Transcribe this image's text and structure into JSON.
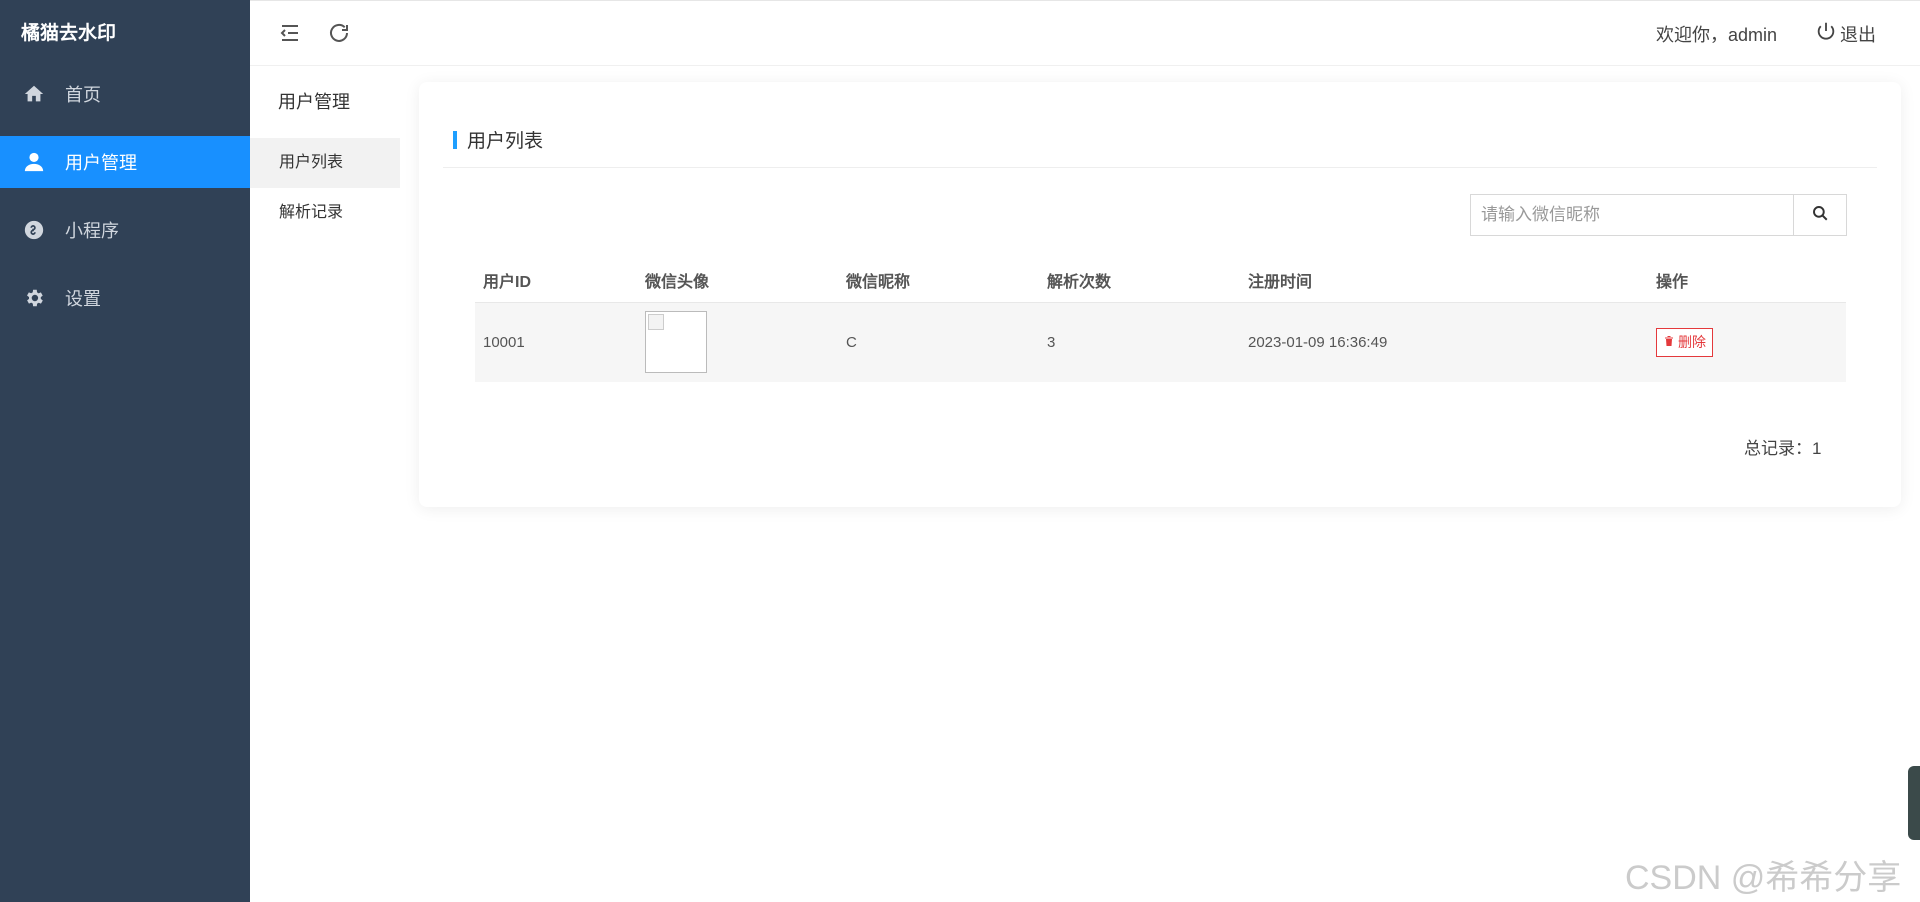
{
  "app": {
    "title": "橘猫去水印"
  },
  "sidebar": {
    "items": [
      {
        "label": "首页",
        "icon": "home-icon"
      },
      {
        "label": "用户管理",
        "icon": "user-icon",
        "active": true
      },
      {
        "label": "小程序",
        "icon": "miniprogram-icon"
      },
      {
        "label": "设置",
        "icon": "gear-icon"
      }
    ]
  },
  "header": {
    "welcome": "欢迎你，admin",
    "logout_label": "退出"
  },
  "submenu": {
    "title": "用户管理",
    "items": [
      {
        "label": "用户列表",
        "active": true
      },
      {
        "label": "解析记录"
      }
    ]
  },
  "card": {
    "title": "用户列表"
  },
  "search": {
    "placeholder": "请输入微信昵称",
    "value": ""
  },
  "table": {
    "columns": [
      "用户ID",
      "微信头像",
      "微信昵称",
      "解析次数",
      "注册时间",
      "操作"
    ],
    "rows": [
      {
        "id": "10001",
        "nickname": "C",
        "count": "3",
        "registered": "2023-01-09 16:36:49",
        "action": "删除"
      }
    ]
  },
  "footer": {
    "total": "总记录：1"
  },
  "watermark": "CSDN @希希分享",
  "colors": {
    "sidebar": "#304156",
    "active": "#1890ff",
    "accent_bar": "#1e9fff",
    "danger": "#e4393c"
  }
}
